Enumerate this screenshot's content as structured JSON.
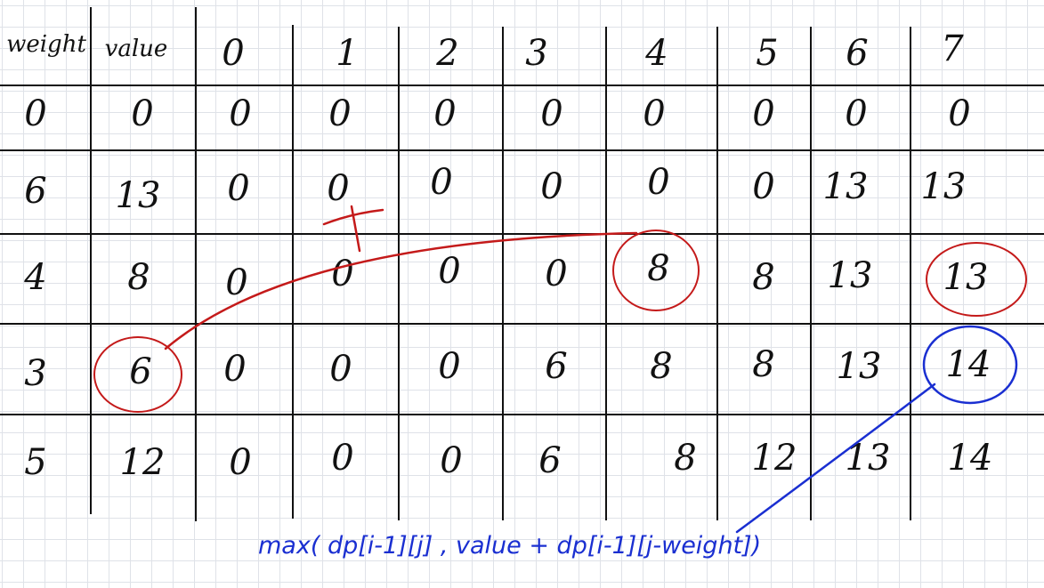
{
  "table": {
    "header": [
      "weight",
      "value",
      "0",
      "1",
      "2",
      "3",
      "4",
      "5",
      "6",
      "7"
    ],
    "rows": [
      [
        "0",
        "0",
        "0",
        "0",
        "0",
        "0",
        "0",
        "0",
        "0",
        "0"
      ],
      [
        "6",
        "13",
        "0",
        "0",
        "0",
        "0",
        "0",
        "0",
        "13",
        "13"
      ],
      [
        "4",
        "8",
        "0",
        "0",
        "0",
        "0",
        "8",
        "8",
        "13",
        "13"
      ],
      [
        "3",
        "6",
        "0",
        "0",
        "0",
        "6",
        "8",
        "8",
        "13",
        "14"
      ],
      [
        "5",
        "12",
        "0",
        "0",
        "0",
        "6",
        "8",
        "12",
        "13",
        "14"
      ]
    ]
  },
  "formula": "max( dp[i-1][j] , value + dp[i-1][j-weight])",
  "colors": {
    "red_ink": "#c41a1a",
    "blue_ink": "#1a2fd1",
    "grid": "#dfe2e8"
  }
}
